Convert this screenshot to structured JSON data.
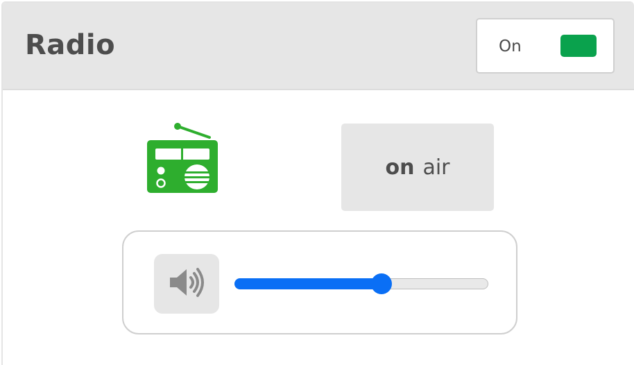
{
  "header": {
    "title": "Radio",
    "power": {
      "label": "On",
      "state": "on",
      "indicator_color": "#0aa24d"
    }
  },
  "radio_icon": {
    "name": "radio-icon",
    "color": "#2eae2e"
  },
  "status": {
    "strong": "on",
    "text": "air"
  },
  "volume": {
    "icon": "speaker-volume-icon",
    "level_fraction": 0.58,
    "accent": "#0a6ff5"
  }
}
